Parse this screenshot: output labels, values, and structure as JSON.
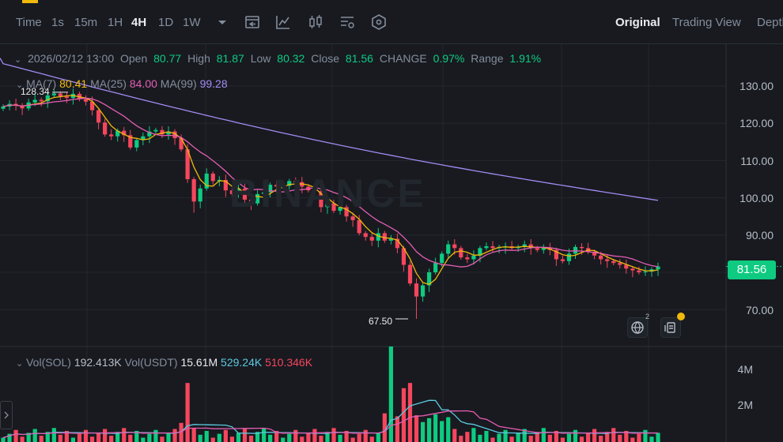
{
  "timeframes": [
    "Time",
    "1s",
    "15m",
    "1H",
    "4H",
    "1D",
    "1W"
  ],
  "active_timeframe": "4H",
  "view_tabs": [
    "Original",
    "Trading View",
    "Depth"
  ],
  "active_view": "Original",
  "ohlc": {
    "date": "2026/02/12 13:00",
    "open_label": "Open",
    "open": "80.77",
    "high_label": "High",
    "high": "81.87",
    "low_label": "Low",
    "low": "80.32",
    "close_label": "Close",
    "close": "81.56",
    "change_label": "CHANGE",
    "change": "0.97%",
    "range_label": "Range",
    "range": "1.91%"
  },
  "ma": {
    "ma7_label": "MA(7)",
    "ma7": "80.41",
    "ma25_label": "MA(25)",
    "ma25": "84.00",
    "ma99_label": "MA(99)",
    "ma99": "99.28"
  },
  "price_axis": [
    "130.00",
    "120.00",
    "110.00",
    "100.00",
    "90.00",
    "70.00"
  ],
  "current_price": "81.56",
  "annotations": {
    "high_mark": "128.34",
    "low_mark": "67.50"
  },
  "watermark": "BINANCE",
  "volume": {
    "sol_label": "Vol(SOL)",
    "sol": "192.413K",
    "usdt_label": "Vol(USDT)",
    "usdt": "15.61M",
    "ma_a": "529.24K",
    "ma_b": "510.346K",
    "axis": [
      "4M",
      "2M"
    ]
  },
  "badges": {
    "globe_count": "2"
  },
  "colors": {
    "up": "#0ecb81",
    "down": "#f6465d",
    "ma7": "#f0b90b",
    "ma25": "#e45db2",
    "ma99": "#a48bf2",
    "accent": "#f0b90b"
  },
  "chart_data": {
    "type": "candlestick",
    "interval": "4H",
    "ylim": [
      62,
      136
    ],
    "closes": [
      124.5,
      125.2,
      124.8,
      124.0,
      125.6,
      126.3,
      125.9,
      127.5,
      128.0,
      127.2,
      126.8,
      127.9,
      126.5,
      125.8,
      123.5,
      120.2,
      117.0,
      116.5,
      118.0,
      116.8,
      113.5,
      115.5,
      116.5,
      117.8,
      118.2,
      117.0,
      117.8,
      116.0,
      113.0,
      105.0,
      99.0,
      102.5,
      106.5,
      104.5,
      104.8,
      102.0,
      101.0,
      102.5,
      99.5,
      98.5,
      101.0,
      101.5,
      103.5,
      103.0,
      103.2,
      104.5,
      104.2,
      103.0,
      102.0,
      101.8,
      97.5,
      98.5,
      96.5,
      97.5,
      95.0,
      94.0,
      90.5,
      89.5,
      88.5,
      90.5,
      88.5,
      89.0,
      86.5,
      82.0,
      77.0,
      73.5,
      76.5,
      80.0,
      82.5,
      85.0,
      87.5,
      86.5,
      84.0,
      83.5,
      84.5,
      86.5,
      87.0,
      86.5,
      86.8,
      87.0,
      86.5,
      86.8,
      87.5,
      86.5,
      86.0,
      86.5,
      86.0,
      83.5,
      83.0,
      85.0,
      86.8,
      86.5,
      85.5,
      84.5,
      83.5,
      83.0,
      82.5,
      82.0,
      81.0,
      80.5,
      80.0,
      80.2,
      80.8,
      81.56
    ],
    "ma7": "orange line",
    "ma25": "pink line",
    "ma99": "purple line"
  }
}
